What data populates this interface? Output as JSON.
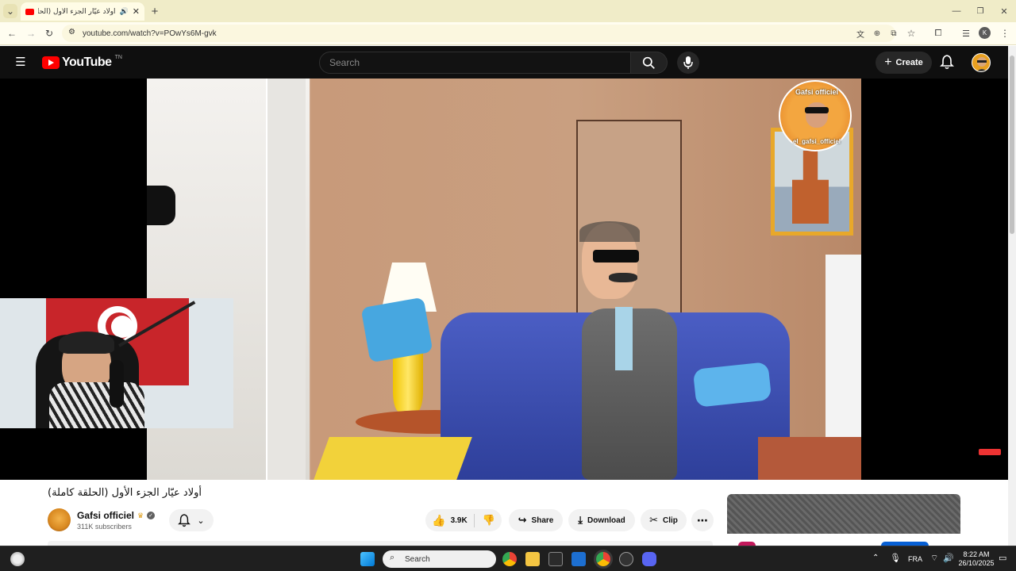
{
  "browser": {
    "tab_title": "أولاد عيّار الجزء الأول (الحلقة ...",
    "url": "youtube.com/watch?v=POwYs6M-gvk",
    "profile_initial": "K"
  },
  "youtube": {
    "logo_text": "YouTube",
    "logo_sup": "TN",
    "search_placeholder": "Search",
    "create_label": "Create"
  },
  "video": {
    "title": "أولاد عيّار الجزء الأول (الحلقة كاملة)",
    "watermark_top": "Gafsi officiel",
    "watermark_bottom": "el_gafsi_officiel"
  },
  "channel": {
    "name": "Gafsi officiel",
    "subscribers": "311K subscribers"
  },
  "actions": {
    "likes": "3.9K",
    "share_label": "Share",
    "download_label": "Download",
    "clip_label": "Clip"
  },
  "taskbar": {
    "search_placeholder": "Search",
    "language": "FRA",
    "time": "8:22 AM",
    "date": "26/10/2025"
  },
  "colors": {
    "youtube_red": "#ff0000",
    "header_bg": "#0f0f0f",
    "tab_strip": "#f0ecc8"
  }
}
